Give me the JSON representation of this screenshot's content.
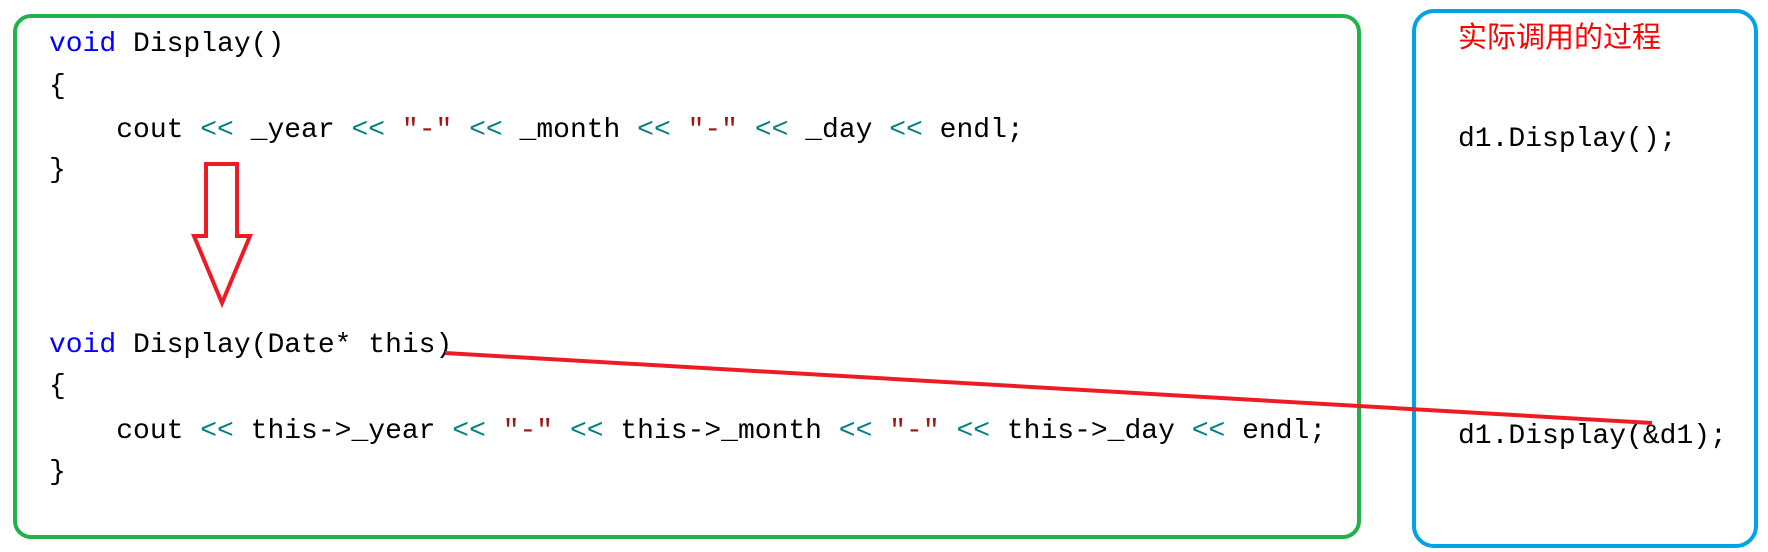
{
  "colors": {
    "left_box": "#22b14c",
    "right_box": "#00a2e8",
    "arrow": "#ed1c24",
    "keyword": "#0000ff",
    "operator": "#008080",
    "string": "#a31515",
    "title": "#ff0000"
  },
  "left_code": [
    [
      [
        "kw",
        "void"
      ],
      [
        "txt",
        " Display()"
      ]
    ],
    [
      [
        "txt",
        "{"
      ]
    ],
    [
      [
        "txt",
        "    cout "
      ],
      [
        "op",
        "<<"
      ],
      [
        "txt",
        " _year "
      ],
      [
        "op",
        "<<"
      ],
      [
        "txt",
        " "
      ],
      [
        "str",
        "\"-\""
      ],
      [
        "txt",
        " "
      ],
      [
        "op",
        "<<"
      ],
      [
        "txt",
        " _month "
      ],
      [
        "op",
        "<<"
      ],
      [
        "txt",
        " "
      ],
      [
        "str",
        "\"-\""
      ],
      [
        "txt",
        " "
      ],
      [
        "op",
        "<<"
      ],
      [
        "txt",
        " _day "
      ],
      [
        "op",
        "<<"
      ],
      [
        "txt",
        " endl;"
      ]
    ],
    [
      [
        "txt",
        "}"
      ]
    ],
    [
      [
        "kw",
        "void"
      ],
      [
        "txt",
        " Display(Date* this)"
      ]
    ],
    [
      [
        "txt",
        "{"
      ]
    ],
    [
      [
        "txt",
        "    cout "
      ],
      [
        "op",
        "<<"
      ],
      [
        "txt",
        " this->_year "
      ],
      [
        "op",
        "<<"
      ],
      [
        "txt",
        " "
      ],
      [
        "str",
        "\"-\""
      ],
      [
        "txt",
        " "
      ],
      [
        "op",
        "<<"
      ],
      [
        "txt",
        " this->_month "
      ],
      [
        "op",
        "<<"
      ],
      [
        "txt",
        " "
      ],
      [
        "str",
        "\"-\""
      ],
      [
        "txt",
        " "
      ],
      [
        "op",
        "<<"
      ],
      [
        "txt",
        " this->_day "
      ],
      [
        "op",
        "<<"
      ],
      [
        "txt",
        " endl;"
      ]
    ],
    [
      [
        "txt",
        "}"
      ]
    ]
  ],
  "right": {
    "title": "实际调用的过程",
    "call1": "d1.Display();",
    "call2": "d1.Display(&d1);"
  }
}
